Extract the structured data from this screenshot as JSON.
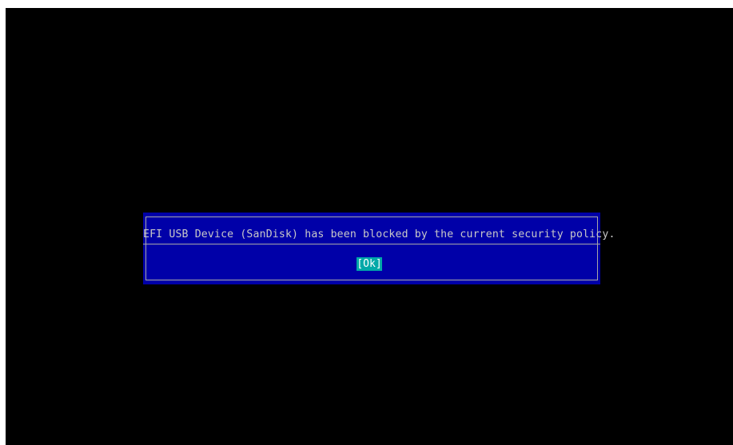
{
  "dialog": {
    "message": "EFI USB Device (SanDisk) has been blocked by the current security policy.",
    "ok_label": "[Ok]"
  },
  "colors": {
    "screen_background": "#000000",
    "dialog_background": "#0000a8",
    "dialog_border": "#a8a8a8",
    "message_text": "#c8c8c8",
    "button_highlight": "#00a8a8",
    "button_text": "#ffffff"
  }
}
